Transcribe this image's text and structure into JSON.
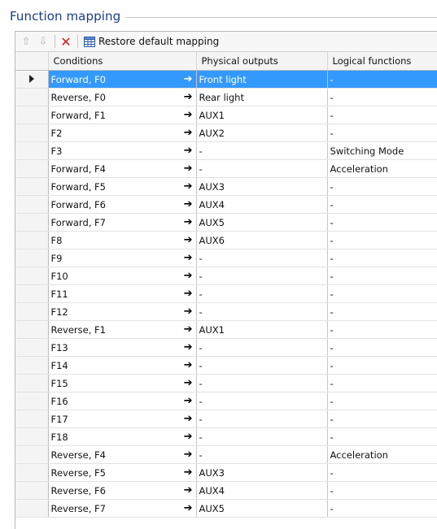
{
  "group": {
    "title": "Function mapping"
  },
  "toolbar": {
    "move_up": "⇧",
    "move_down": "⇩",
    "delete": "✕",
    "restore_label": "Restore default mapping"
  },
  "columns": [
    "Conditions",
    "Physical outputs",
    "Logical functions"
  ],
  "arrow_glyph": "➔",
  "rows": [
    {
      "condition": "Forward, F0",
      "physical": "Front light",
      "logical": "-"
    },
    {
      "condition": "Reverse, F0",
      "physical": "Rear light",
      "logical": "-"
    },
    {
      "condition": "Forward, F1",
      "physical": "AUX1",
      "logical": "-"
    },
    {
      "condition": "F2",
      "physical": "AUX2",
      "logical": "-"
    },
    {
      "condition": "F3",
      "physical": "-",
      "logical": "Switching Mode"
    },
    {
      "condition": "Forward, F4",
      "physical": "-",
      "logical": "Acceleration"
    },
    {
      "condition": "Forward, F5",
      "physical": "AUX3",
      "logical": "-"
    },
    {
      "condition": "Forward, F6",
      "physical": "AUX4",
      "logical": "-"
    },
    {
      "condition": "Forward, F7",
      "physical": "AUX5",
      "logical": "-"
    },
    {
      "condition": "F8",
      "physical": "AUX6",
      "logical": "-"
    },
    {
      "condition": "F9",
      "physical": "-",
      "logical": "-"
    },
    {
      "condition": "F10",
      "physical": "-",
      "logical": "-"
    },
    {
      "condition": "F11",
      "physical": "-",
      "logical": "-"
    },
    {
      "condition": "F12",
      "physical": "-",
      "logical": "-"
    },
    {
      "condition": "Reverse, F1",
      "physical": "AUX1",
      "logical": "-"
    },
    {
      "condition": "F13",
      "physical": "-",
      "logical": "-"
    },
    {
      "condition": "F14",
      "physical": "-",
      "logical": "-"
    },
    {
      "condition": "F15",
      "physical": "-",
      "logical": "-"
    },
    {
      "condition": "F16",
      "physical": "-",
      "logical": "-"
    },
    {
      "condition": "F17",
      "physical": "-",
      "logical": "-"
    },
    {
      "condition": "F18",
      "physical": "-",
      "logical": "-"
    },
    {
      "condition": "Reverse, F4",
      "physical": "-",
      "logical": "Acceleration"
    },
    {
      "condition": "Reverse, F5",
      "physical": "AUX3",
      "logical": "-"
    },
    {
      "condition": "Reverse, F6",
      "physical": "AUX4",
      "logical": "-"
    },
    {
      "condition": "Reverse, F7",
      "physical": "AUX5",
      "logical": "-"
    }
  ],
  "selected_row": 0,
  "colors": {
    "selection": "#3399ff",
    "title": "#1a3a8c",
    "delete": "#d21b1b"
  }
}
